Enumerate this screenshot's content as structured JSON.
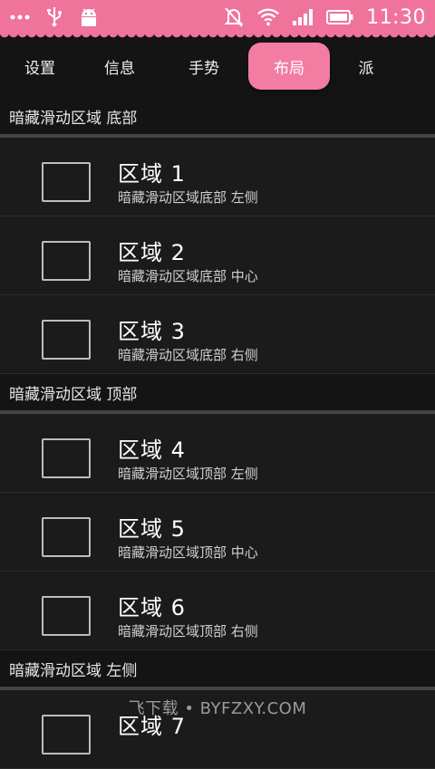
{
  "status_bar": {
    "time": "11:30",
    "icons": [
      "more-dots-icon",
      "usb-icon",
      "android-debug-icon",
      "alarm-off-icon",
      "wifi-icon",
      "signal-icon",
      "battery-icon"
    ]
  },
  "tabs": [
    {
      "label": "设置"
    },
    {
      "label": "信息"
    },
    {
      "label": "手势"
    },
    {
      "label": "布局",
      "active": true
    },
    {
      "label": "派"
    }
  ],
  "sections": [
    {
      "header": "暗藏滑动区域 底部",
      "items": [
        {
          "title": "区域 1",
          "subtitle": "暗藏滑动区域底部 左侧"
        },
        {
          "title": "区域 2",
          "subtitle": "暗藏滑动区域底部 中心"
        },
        {
          "title": "区域 3",
          "subtitle": "暗藏滑动区域底部 右侧"
        }
      ]
    },
    {
      "header": "暗藏滑动区域 顶部",
      "items": [
        {
          "title": "区域 4",
          "subtitle": "暗藏滑动区域顶部 左侧"
        },
        {
          "title": "区域 5",
          "subtitle": "暗藏滑动区域顶部 中心"
        },
        {
          "title": "区域 6",
          "subtitle": "暗藏滑动区域顶部 右侧"
        }
      ]
    },
    {
      "header": "暗藏滑动区域 左侧",
      "items": [
        {
          "title": "区域 7",
          "subtitle": ""
        }
      ]
    }
  ],
  "watermark": "飞下载 • BYFZXY.COM",
  "colors": {
    "accent": "#f0739c",
    "background": "#121212"
  }
}
